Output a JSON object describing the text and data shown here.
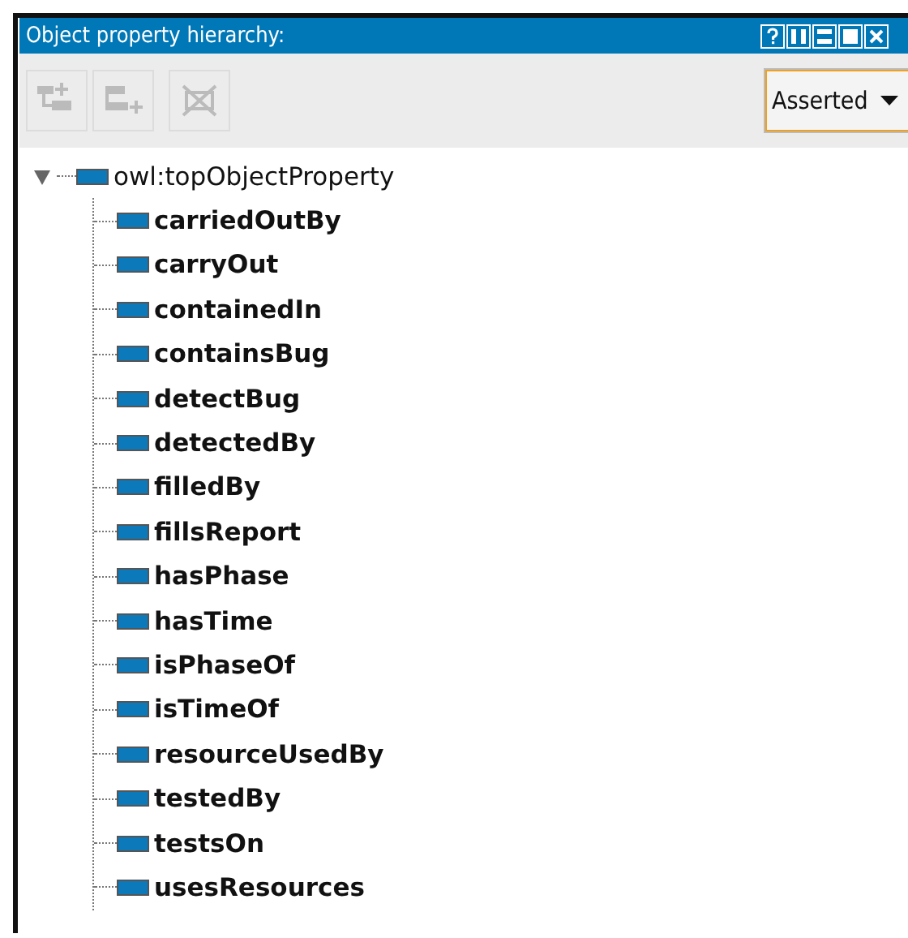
{
  "panel": {
    "title": "Object property hierarchy:"
  },
  "toolbar": {
    "buttons": [
      {
        "kind": "add-sub",
        "disabled": true
      },
      {
        "kind": "add-sibling",
        "disabled": true
      },
      {
        "kind": "delete",
        "disabled": true
      }
    ],
    "view_dropdown": {
      "value": "Asserted"
    }
  },
  "tree": {
    "label": "owl:topObjectProperty",
    "expanded": true,
    "children": [
      {
        "label": "carriedOutBy"
      },
      {
        "label": "carryOut"
      },
      {
        "label": "containedIn"
      },
      {
        "label": "containsBug"
      },
      {
        "label": "detectBug"
      },
      {
        "label": "detectedBy"
      },
      {
        "label": "filledBy"
      },
      {
        "label": "fillsReport"
      },
      {
        "label": "hasPhase"
      },
      {
        "label": "hasTime"
      },
      {
        "label": "isPhaseOf"
      },
      {
        "label": "isTimeOf"
      },
      {
        "label": "resourceUsedBy"
      },
      {
        "label": "testedBy"
      },
      {
        "label": "testsOn"
      },
      {
        "label": "usesResources"
      }
    ]
  }
}
